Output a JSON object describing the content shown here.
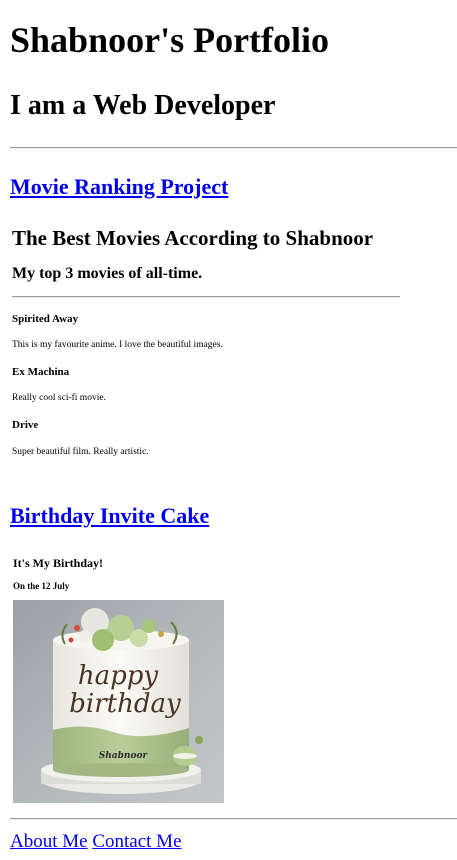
{
  "header": {
    "title": "Shabnoor's Portfolio",
    "subtitle": "I am a Web Developer"
  },
  "projects": [
    {
      "link_text": "Movie Ranking Project",
      "heading": "The Best Movies According to Shabnoor",
      "subheading": "My top 3 movies of all-time.",
      "movies": [
        {
          "title": "Spirited Away",
          "description": "This is my favourite anime. I love the beautiful images."
        },
        {
          "title": "Ex Machina",
          "description": "Really cool sci-fi movie."
        },
        {
          "title": "Drive",
          "description": "Super beautiful film. Really artistic."
        }
      ]
    },
    {
      "link_text": "Birthday Invite Cake",
      "heading": "It's My Birthday!",
      "date_text": "On the 12 July",
      "image_text": {
        "script_line1": "happy",
        "script_line2": "birthday",
        "band_name": "Shabnoor"
      }
    }
  ],
  "footer": {
    "links": [
      "About Me",
      "Contact Me"
    ]
  },
  "colors": {
    "link": "#0000ee",
    "rule": "#9a9a9a",
    "cake_green": "#a9c08a",
    "cake_cream": "#f4f1ea",
    "background_gray": "#a8adb0"
  }
}
